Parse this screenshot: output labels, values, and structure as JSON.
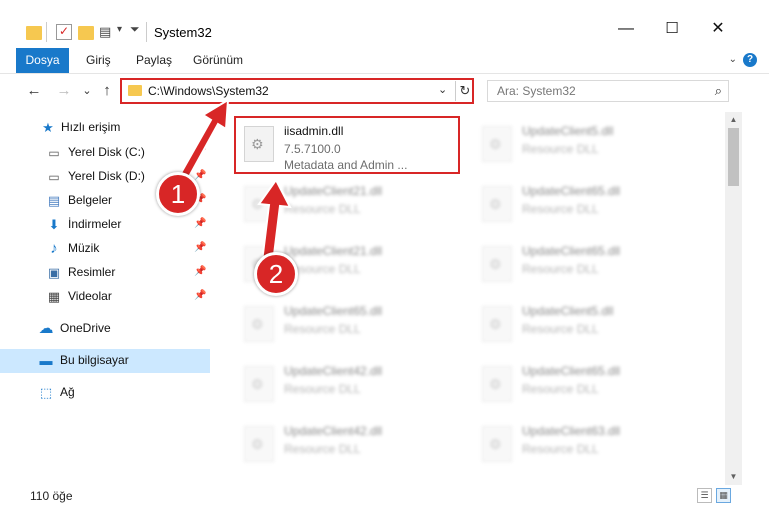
{
  "window": {
    "title": "System32",
    "minimize": "—",
    "maximize": "☐",
    "close": "✕"
  },
  "ribbon": {
    "tabs": [
      "Dosya",
      "Giriş",
      "Paylaş",
      "Görünüm"
    ],
    "help": "?"
  },
  "nav": {
    "back": "←",
    "forward": "→",
    "recent": "⌄",
    "up": "↑"
  },
  "address": {
    "path": "C:\\Windows\\System32",
    "dropdown": "⌄",
    "refresh": "↻"
  },
  "search": {
    "placeholder": "Ara: System32",
    "icon": "⌕"
  },
  "sidebar": {
    "items": [
      {
        "label": "Hızlı erişim",
        "icon": "star-icon",
        "glyph": "★",
        "color": "#1979ca"
      },
      {
        "label": "Yerel Disk (C:)",
        "icon": "drive-icon",
        "glyph": "▭",
        "color": "#555555",
        "pin": "📌"
      },
      {
        "label": "Yerel Disk (D:)",
        "icon": "drive-icon",
        "glyph": "▭",
        "color": "#555555",
        "pin": "📌"
      },
      {
        "label": "Belgeler",
        "icon": "documents-icon",
        "glyph": "▤",
        "color": "#4a7fc1",
        "pin": "📌"
      },
      {
        "label": "İndirmeler",
        "icon": "downloads-icon",
        "glyph": "⬇",
        "color": "#1979ca",
        "pin": "📌"
      },
      {
        "label": "Müzik",
        "icon": "music-icon",
        "glyph": "♪",
        "color": "#1979ca",
        "pin": "📌"
      },
      {
        "label": "Resimler",
        "icon": "pictures-icon",
        "glyph": "▣",
        "color": "#3a6ea5",
        "pin": "📌"
      },
      {
        "label": "Videolar",
        "icon": "videos-icon",
        "glyph": "▦",
        "color": "#444444",
        "pin": "📌"
      },
      {
        "label": "OneDrive",
        "icon": "onedrive-icon",
        "glyph": "☁",
        "color": "#1979ca"
      },
      {
        "label": "Bu bilgisayar",
        "icon": "computer-icon",
        "glyph": "▬",
        "color": "#1979ca"
      },
      {
        "label": "Ağ",
        "icon": "network-icon",
        "glyph": "⬚",
        "color": "#1979ca"
      }
    ]
  },
  "files": {
    "selected": {
      "name": "iisadmin.dll",
      "version": "7.5.7100.0",
      "description": "Metadata and Admin ..."
    },
    "others": [
      {
        "name": "UpdateClient5.dll",
        "type": "Resource DLL"
      },
      {
        "name": "UpdateClient21.dll",
        "type": "Resource DLL"
      },
      {
        "name": "UpdateClient65.dll",
        "type": "Resource DLL"
      },
      {
        "name": "UpdateClient21.dll",
        "type": "Resource DLL"
      },
      {
        "name": "UpdateClient65.dll",
        "type": "Resource DLL"
      },
      {
        "name": "UpdateClient65.dll",
        "type": "Resource DLL"
      },
      {
        "name": "UpdateClient5.dll",
        "type": "Resource DLL"
      },
      {
        "name": "UpdateClient42.dll",
        "type": "Resource DLL"
      },
      {
        "name": "UpdateClient65.dll",
        "type": "Resource DLL"
      },
      {
        "name": "UpdateClient42.dll",
        "type": "Resource DLL"
      },
      {
        "name": "UpdateClient63.dll",
        "type": "Resource DLL"
      }
    ]
  },
  "status": {
    "count": "110 öğe",
    "details_view": "☰",
    "tiles_view": "▦"
  },
  "annotations": {
    "step1": "1",
    "step2": "2",
    "color": "#d82626"
  },
  "colors": {
    "accent": "#1979ca",
    "selection": "#cce8ff"
  }
}
